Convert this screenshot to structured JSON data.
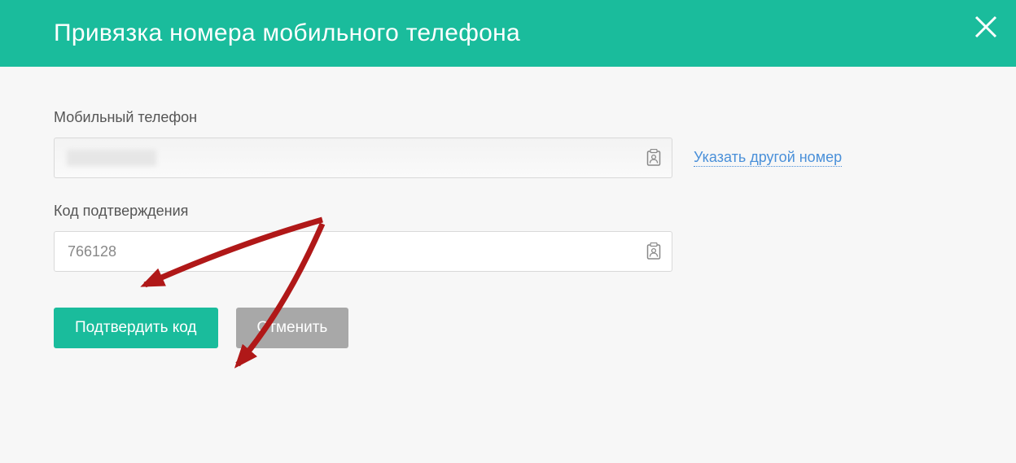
{
  "colors": {
    "primary": "#1abc9c",
    "secondary": "#a8a8a8",
    "link": "#4a90d9",
    "arrow": "#b01818"
  },
  "header": {
    "title": "Привязка номера мобильного телефона"
  },
  "phone": {
    "label": "Мобильный телефон",
    "value": "",
    "icons": {
      "change_link_icon": "contact-card-icon"
    }
  },
  "change_link": "Указать другой номер",
  "code": {
    "label": "Код подтверждения",
    "value": "766128"
  },
  "buttons": {
    "confirm": "Подтвердить код",
    "cancel": "Отменить"
  }
}
